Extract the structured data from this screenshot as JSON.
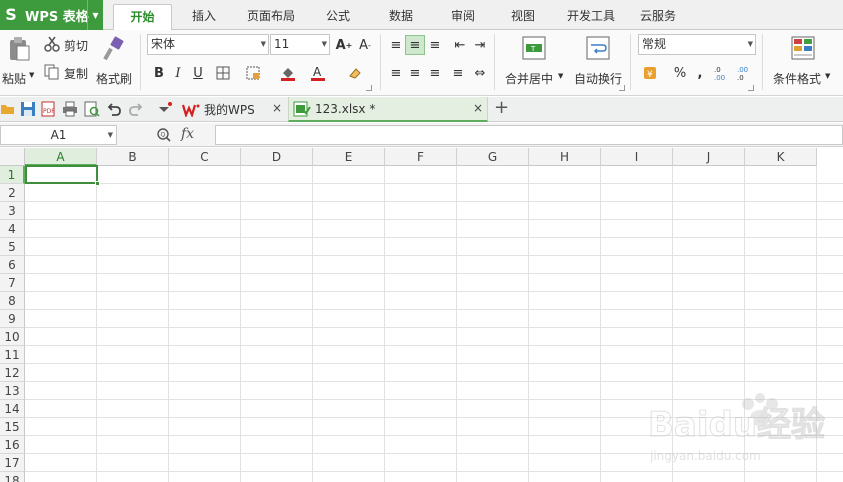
{
  "app": {
    "title": "WPS 表格",
    "logo_glyph": "S",
    "accent": "#3d9a3d"
  },
  "menu": {
    "tabs": [
      {
        "label": "开始",
        "active": true
      },
      {
        "label": "插入"
      },
      {
        "label": "页面布局"
      },
      {
        "label": "公式"
      },
      {
        "label": "数据"
      },
      {
        "label": "审阅"
      },
      {
        "label": "视图"
      },
      {
        "label": "开发工具"
      },
      {
        "label": "云服务"
      }
    ]
  },
  "ribbon": {
    "clipboard": {
      "paste": "粘贴",
      "cut": "剪切",
      "copy": "复制",
      "format_painter": "格式刷"
    },
    "font": {
      "name": "宋体",
      "size": "11",
      "bold": "B",
      "italic": "I",
      "underline": "U"
    },
    "alignment": {
      "merge_center": "合并居中",
      "wrap_text": "自动换行"
    },
    "number": {
      "format": "常规",
      "percent": "%",
      "comma": ","
    },
    "styles": {
      "conditional_format": "条件格式"
    }
  },
  "doc_tabs": [
    {
      "label": "我的WPS",
      "close": "×"
    },
    {
      "label": "123.xlsx *",
      "close": "×",
      "active": true
    }
  ],
  "new_tab": "+",
  "formula_bar": {
    "cell_ref": "A1",
    "fx": "fx"
  },
  "sheet": {
    "columns": [
      "A",
      "B",
      "C",
      "D",
      "E",
      "F",
      "G",
      "H",
      "I",
      "J",
      "K"
    ],
    "rows": [
      "1",
      "2",
      "3",
      "4",
      "5",
      "6",
      "7",
      "8",
      "9",
      "10",
      "11",
      "12",
      "13",
      "14",
      "15",
      "16",
      "17",
      "18"
    ],
    "selected_cell": "A1",
    "selection_color": "#3e8e3e"
  },
  "watermark": {
    "brand": "Baidu经验",
    "url": "jingyan.baidu.com"
  }
}
